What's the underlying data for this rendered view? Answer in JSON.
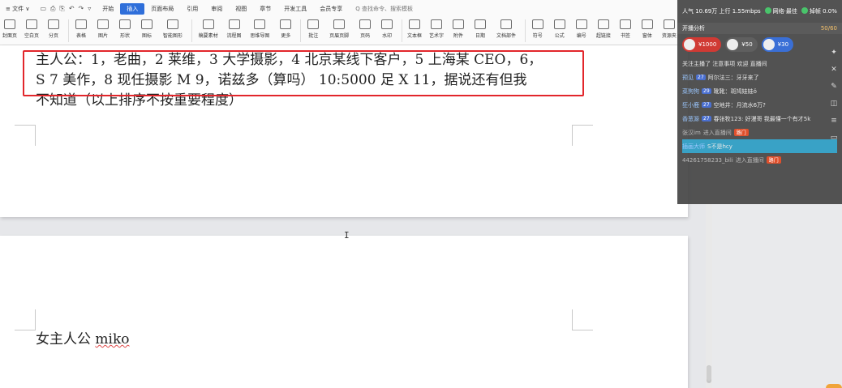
{
  "menubar": {
    "file_label": "≡ 文件 ∨",
    "quick_icons": [
      "▭",
      "⎙",
      "⎘",
      "↶",
      "↷",
      "▿"
    ],
    "tabs": [
      "开始",
      "插入",
      "页面布局",
      "引用",
      "审阅",
      "视图",
      "章节",
      "开发工具",
      "会员专享"
    ],
    "active_tab": "插入",
    "search_text": "Q 查找命令、搜索模板"
  },
  "ribbon": {
    "buttons": [
      "封面页",
      "空白页",
      "分页",
      "表格",
      "图片",
      "形状",
      "图标",
      "智能图形",
      "稿要素材",
      "流程图",
      "思维导图",
      "更多",
      "批注",
      "页眉页脚",
      "页码",
      "水印",
      "文本框",
      "艺术字",
      "附件",
      "日期",
      "文档部件",
      "符号",
      "公式",
      "编号",
      "超链接",
      "书签",
      "窗体",
      "资源夹"
    ]
  },
  "document": {
    "line1": "主人公：1，老曲，2 莱维，3 大学摄影，4 北京某线下客户，5 上海某 CEO，6，",
    "line2": "S 7 美作，8 现任摄影 M  9，诺兹多（算吗） 10:5000 足 X 11，据说还有但我",
    "line3": "不知道（以上排序不按重要程度）",
    "page2_prefix": "女主人公 ",
    "page2_name": "miko",
    "cursor": "I"
  },
  "overlay": {
    "top_stats": "人气 10.69万  上行 1.55mbps",
    "indicator_a": "网络·最佳",
    "indicator_b": "掉帧 0.0%",
    "bar_label": "开播分析",
    "bar_progress": "50/60",
    "gifts": [
      {
        "amount": "¥1000",
        "color": "#d03a34"
      },
      {
        "amount": "¥50",
        "color": "#5f5f5f"
      },
      {
        "amount": "¥30",
        "color": "#3a6fd6"
      }
    ],
    "messages": [
      {
        "user": "",
        "level": "",
        "text": "关注主播了 注意事项 欢迎 直播间",
        "type": "system"
      },
      {
        "user": "预见",
        "level": "27",
        "text": "阿尔法三：牙牙来了",
        "type": "chat"
      },
      {
        "user": "菜狗狗",
        "level": "29",
        "text": "靴靴：斑鸠娃娃ǒ",
        "type": "chat"
      },
      {
        "user": "狂小鹿",
        "level": "27",
        "text": "空地井：月流水6万?",
        "type": "chat"
      },
      {
        "user": "香葱源",
        "level": "27",
        "text": "春张牧123: 好漫哥 我最懂一个有才5k",
        "type": "chat"
      },
      {
        "user": "张汉im",
        "level": "",
        "text": "进入直播间",
        "type": "enter"
      },
      {
        "user": "插画大师",
        "level": "",
        "text": "S不是hcy",
        "type": "highlight"
      },
      {
        "user": "44261758233_bili",
        "level": "",
        "text": "进入直播间",
        "type": "enter"
      }
    ],
    "badge_label": "路门",
    "side_icons": [
      "✦",
      "✕",
      "✎",
      "◫",
      "≡",
      "▭"
    ]
  }
}
